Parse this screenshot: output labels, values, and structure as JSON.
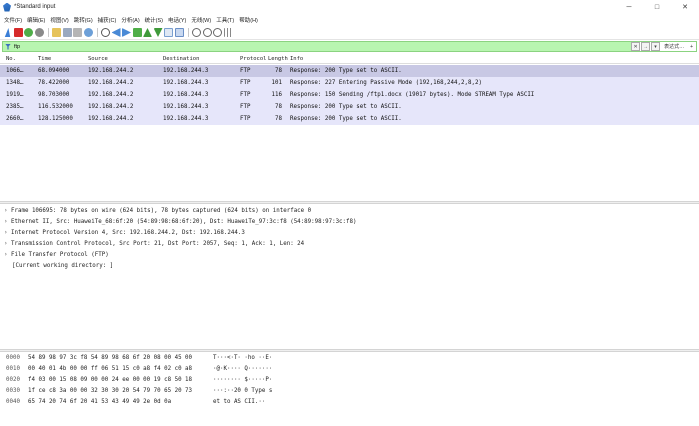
{
  "window": {
    "title": "*Standard input",
    "minimize": "─",
    "maximize": "□",
    "close": "✕"
  },
  "menu": [
    "文件(F)",
    "编辑(E)",
    "视图(V)",
    "跳转(G)",
    "捕获(C)",
    "分析(A)",
    "统计(S)",
    "电话(Y)",
    "无线(W)",
    "工具(T)",
    "帮助(H)"
  ],
  "toolbar_icons": [
    "shark-fin-icon",
    "stop-icon",
    "restart-icon",
    "options-icon",
    "open-icon",
    "save-icon",
    "close-file-icon",
    "reload-icon",
    "find-icon",
    "back-icon",
    "forward-icon",
    "goto-icon",
    "first-icon",
    "last-icon",
    "autoscroll-icon",
    "colorize-icon",
    "zoom-in-icon",
    "zoom-out-icon",
    "zoom-reset-icon",
    "resize-columns-icon"
  ],
  "filter": {
    "value": "ftp",
    "expression_label": "表达式…",
    "plus_label": "+"
  },
  "columns": {
    "no": "No.",
    "time": "Time",
    "source": "Source",
    "destination": "Destination",
    "protocol": "Protocol",
    "length": "Length",
    "info": "Info"
  },
  "packets": [
    {
      "no": "1066…",
      "time": "68.094000",
      "src": "192.168.244.2",
      "dst": "192.168.244.3",
      "proto": "FTP",
      "len": "78",
      "info": "Response: 200 Type set to ASCII."
    },
    {
      "no": "1348…",
      "time": "78.422000",
      "src": "192.168.244.2",
      "dst": "192.168.244.3",
      "proto": "FTP",
      "len": "101",
      "info": "Response: 227 Entering Passive Mode (192,168,244,2,8,2)"
    },
    {
      "no": "1919…",
      "time": "98.703000",
      "src": "192.168.244.2",
      "dst": "192.168.244.3",
      "proto": "FTP",
      "len": "116",
      "info": "Response: 150 Sending /ftp1.docx (19017 bytes). Mode STREAM Type ASCII"
    },
    {
      "no": "2385…",
      "time": "116.532000",
      "src": "192.168.244.2",
      "dst": "192.168.244.3",
      "proto": "FTP",
      "len": "78",
      "info": "Response: 200 Type set to ASCII."
    },
    {
      "no": "2660…",
      "time": "128.125000",
      "src": "192.168.244.2",
      "dst": "192.168.244.3",
      "proto": "FTP",
      "len": "78",
      "info": "Response: 200 Type set to ASCII."
    }
  ],
  "details": [
    {
      "arrow": "›",
      "text": "Frame 106695: 78 bytes on wire (624 bits), 78 bytes captured (624 bits) on interface 0"
    },
    {
      "arrow": "›",
      "text": "Ethernet II, Src: HuaweiTe_68:6f:20 (54:89:98:68:6f:20), Dst: HuaweiTe_97:3c:f8 (54:89:98:97:3c:f8)"
    },
    {
      "arrow": "›",
      "text": "Internet Protocol Version 4, Src: 192.168.244.2, Dst: 192.168.244.3"
    },
    {
      "arrow": "›",
      "text": "Transmission Control Protocol, Src Port: 21, Dst Port: 2057, Seq: 1, Ack: 1, Len: 24"
    },
    {
      "arrow": "›",
      "text": "File Transfer Protocol (FTP)"
    },
    {
      "arrow": "",
      "text": "[Current working directory: ]"
    }
  ],
  "hex": [
    {
      "offset": "0000",
      "bytes": "54 89 98 97 3c f8 54 89  98 68 6f 20 08 00 45 00",
      "ascii": "T···<·T· ·ho ··E·"
    },
    {
      "offset": "0010",
      "bytes": "00 40 01 4b 00 00 ff 06  51 15 c0 a8 f4 02 c0 a8",
      "ascii": "·@·K···· Q·······"
    },
    {
      "offset": "0020",
      "bytes": "f4 03 00 15 08 09 00 00  24 ee 00 00 19 c8 50 18",
      "ascii": "········ $·····P·"
    },
    {
      "offset": "0030",
      "bytes": "1f ce c8 3a 00 00 32 30  30 20 54 79 70 65 20 73",
      "ascii": "···:··20 0 Type s"
    },
    {
      "offset": "0040",
      "bytes": "65 74 20 74 6f 20 41 53  43 49 49 2e 0d 0a",
      "ascii": "et to AS CII.··"
    }
  ]
}
